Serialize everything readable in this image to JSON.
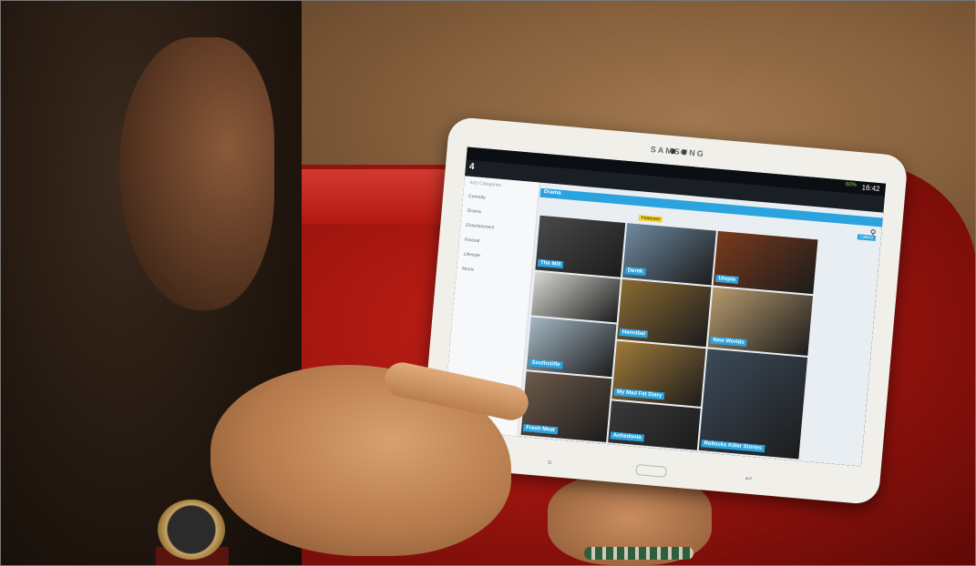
{
  "photo": {
    "tablet_brand": "SAMSUNG",
    "status": {
      "time": "16:42",
      "battery": "60%"
    },
    "app": {
      "sidebar": {
        "title": "4oD Categories",
        "items": [
          "Comedy",
          "Drama",
          "Entertainment",
          "Factual",
          "Lifestyle",
          "Music"
        ]
      },
      "section_title": "Drama",
      "subtabs": {
        "featured": "Featured",
        "latest": "Latest"
      },
      "tiles": [
        {
          "caption": "The Mill",
          "color": "#4a4a4a"
        },
        {
          "caption": "Derek",
          "color": "#6f8aa0"
        },
        {
          "caption": "Utopia",
          "color": "#7a3a1c"
        },
        {
          "caption": "",
          "color": "#d8d8d2"
        },
        {
          "caption": "Southcliffe",
          "color": "#a4b8c4"
        },
        {
          "caption": "Hannibal",
          "color": "#8a6a32"
        },
        {
          "caption": "New Worlds",
          "color": "#b79a6e"
        },
        {
          "caption": "Fresh Meat",
          "color": "#6e5a4a"
        },
        {
          "caption": "My Mad Fat Diary",
          "color": "#a07a3a"
        },
        {
          "caption": "Anhedonia",
          "color": "#3a3a3a"
        },
        {
          "caption": "Rollocks Killer Stories",
          "color": "#3c4a5a"
        }
      ]
    }
  }
}
